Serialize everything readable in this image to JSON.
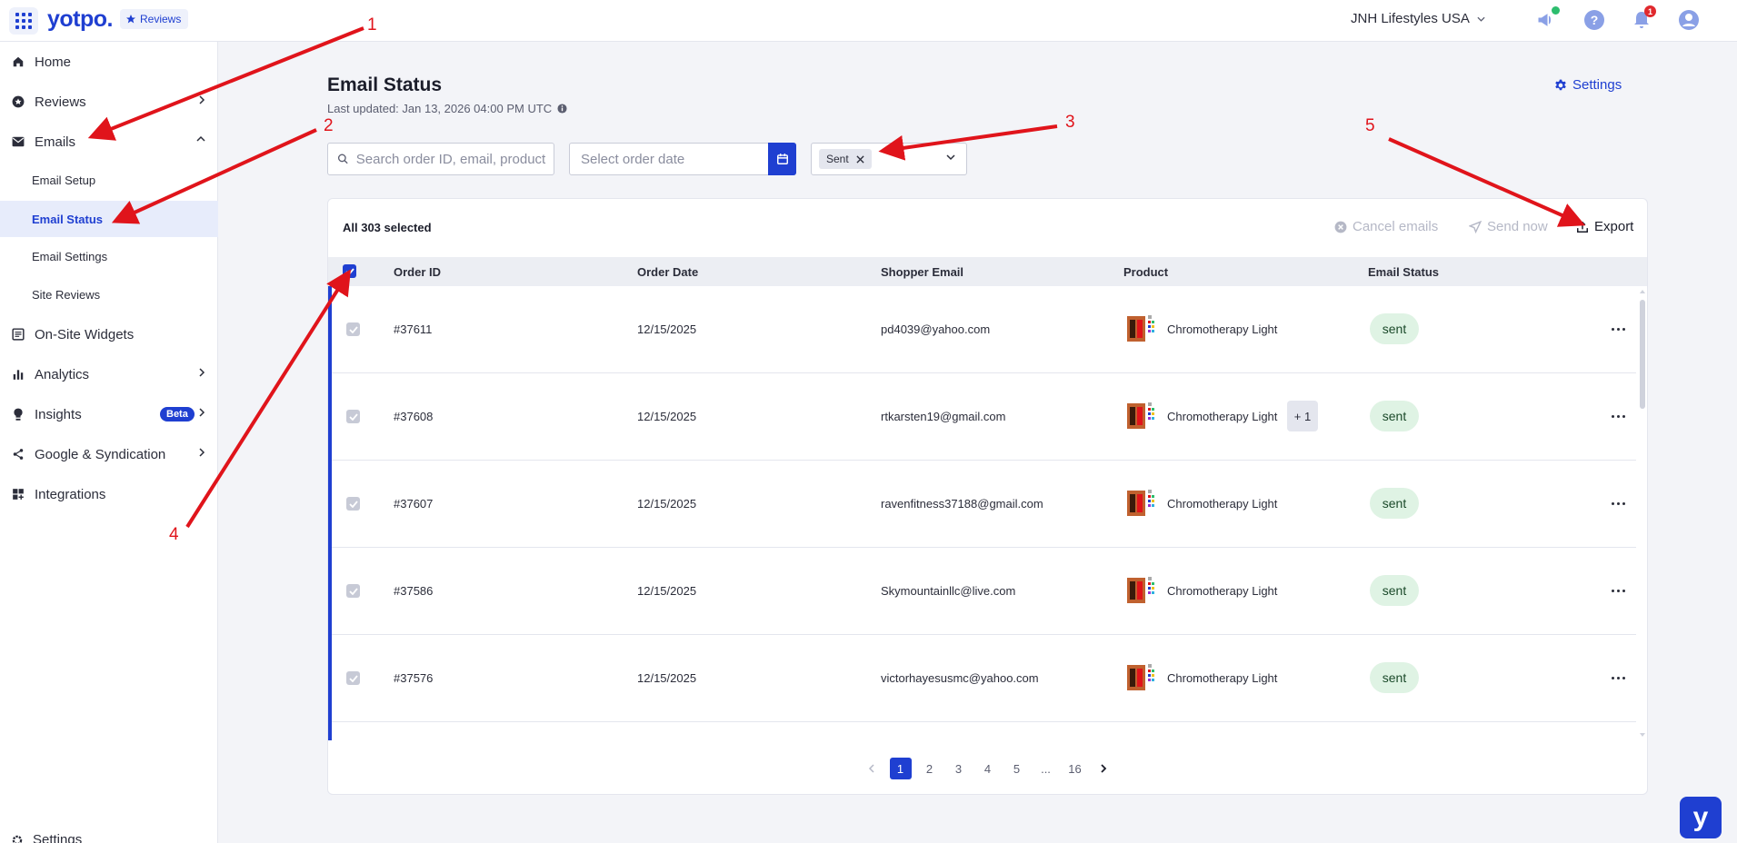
{
  "topbar": {
    "logo": "yotpo.",
    "product": "Reviews",
    "store": "JNH Lifestyles USA",
    "notification_count": "1"
  },
  "sidebar": {
    "items": [
      {
        "label": "Home",
        "icon": "home-icon"
      },
      {
        "label": "Reviews",
        "icon": "star-icon"
      },
      {
        "label": "Emails",
        "icon": "mail-icon"
      },
      {
        "label": "On-Site Widgets",
        "icon": "widget-icon"
      },
      {
        "label": "Analytics",
        "icon": "bar-chart-icon"
      },
      {
        "label": "Insights",
        "icon": "lightbulb-icon",
        "badge": "Beta"
      },
      {
        "label": "Google & Syndication",
        "icon": "share-icon"
      },
      {
        "label": "Integrations",
        "icon": "grid-plus-icon"
      }
    ],
    "email_sub": [
      "Email Setup",
      "Email Status",
      "Email Settings",
      "Site Reviews"
    ],
    "bottom_settings": "Settings"
  },
  "header": {
    "title": "Email Status",
    "last_updated": "Last updated: Jan 13, 2026 04:00 PM UTC",
    "settings_label": "Settings"
  },
  "filters": {
    "search_placeholder": "Search order ID, email, product",
    "date_placeholder": "Select order date",
    "status_chip": "Sent"
  },
  "table": {
    "selected_label": "All 303 selected",
    "actions": {
      "cancel": "Cancel emails",
      "send": "Send now",
      "export": "Export"
    },
    "columns": [
      "Order ID",
      "Order Date",
      "Shopper Email",
      "Product",
      "Email Status"
    ],
    "rows": [
      {
        "order_id": "#37611",
        "date": "12/15/2025",
        "email": "pd4039@yahoo.com",
        "product": "Chromotherapy Light",
        "extra": "",
        "status": "sent"
      },
      {
        "order_id": "#37608",
        "date": "12/15/2025",
        "email": "rtkarsten19@gmail.com",
        "product": "Chromotherapy Light",
        "extra": "+ 1",
        "status": "sent"
      },
      {
        "order_id": "#37607",
        "date": "12/15/2025",
        "email": "ravenfitness37188@gmail.com",
        "product": "Chromotherapy Light",
        "extra": "",
        "status": "sent"
      },
      {
        "order_id": "#37586",
        "date": "12/15/2025",
        "email": "Skymountainllc@live.com",
        "product": "Chromotherapy Light",
        "extra": "",
        "status": "sent"
      },
      {
        "order_id": "#37576",
        "date": "12/15/2025",
        "email": "victorhayesusmc@yahoo.com",
        "product": "Chromotherapy Light",
        "extra": "",
        "status": "sent"
      }
    ]
  },
  "pagination": {
    "pages": [
      "1",
      "2",
      "3",
      "4",
      "5",
      "...",
      "16"
    ],
    "current": "1"
  },
  "annotations": {
    "labels": [
      "1",
      "2",
      "3",
      "4",
      "5"
    ],
    "color": "#e0141b"
  },
  "colors": {
    "brand": "#1f3fd1",
    "sent_bg": "#dff3e4",
    "annotation": "#e0141b"
  }
}
